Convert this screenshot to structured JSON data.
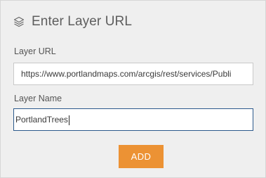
{
  "panel": {
    "title": "Enter Layer URL",
    "title_icon": "layers-icon"
  },
  "form": {
    "layer_url_label": "Layer URL",
    "layer_url_value": "https://www.portlandmaps.com/arcgis/rest/services/Publi",
    "layer_name_label": "Layer Name",
    "layer_name_value": "PortlandTrees",
    "add_label": "ADD"
  },
  "colors": {
    "accent": "#ec9234",
    "focus_border": "#2c5a8c",
    "panel_bg": "#efefef"
  }
}
